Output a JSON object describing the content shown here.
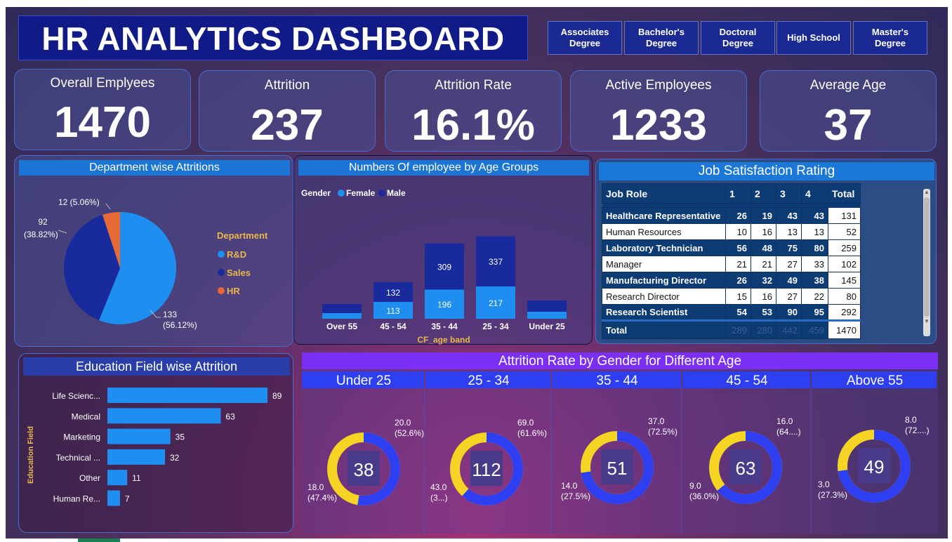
{
  "title": "HR ANALYTICS DASHBOARD",
  "education_slicer": [
    "Associates\nDegree",
    "Bachelor's\nDegree",
    "Doctoral\nDegree",
    "High School",
    "Master's\nDegree"
  ],
  "kpis": [
    {
      "label": "Overall Emplyees",
      "value": "1470"
    },
    {
      "label": "Attrition",
      "value": "237"
    },
    {
      "label": "Attrition Rate",
      "value": "16.1%"
    },
    {
      "label": "Active Employees",
      "value": "1233"
    },
    {
      "label": "Average Age",
      "value": "37"
    }
  ],
  "dept_panel": {
    "title": "Department wise Attritions",
    "legend_title": "Department",
    "legend_color": "#e8b84a"
  },
  "age_panel": {
    "title": "Numbers Of employee by Age Groups",
    "legend_label": "Gender",
    "xlabel": "CF_age band"
  },
  "job_panel": {
    "title": "Job Satisfaction Rating",
    "headers": [
      "Job Role",
      "1",
      "2",
      "3",
      "4",
      "Total"
    ]
  },
  "edu_panel": {
    "title": "Education Field wise Attrition",
    "ylabel": "Education Field"
  },
  "gender_panel": {
    "title": "Attrition Rate by Gender for Different Age"
  },
  "colors": {
    "male": "#182a9c",
    "female": "#1e8ef0",
    "hr": "#e56a36",
    "donut_blue": "#2e3ff2",
    "donut_yellow": "#f5d424",
    "bar": "#1e8ef0"
  },
  "chart_data": [
    {
      "type": "pie",
      "title": "Department wise Attritions",
      "categories": [
        "R&D",
        "Sales",
        "HR"
      ],
      "values": [
        133,
        92,
        12
      ],
      "labels": [
        "133\n(56.12%)",
        "92\n(38.82%)",
        "12 (5.06%)"
      ]
    },
    {
      "type": "bar",
      "stacked": true,
      "title": "Numbers Of employee by Age Groups",
      "xlabel": "CF_age band",
      "categories": [
        "Over 55",
        "45 - 54",
        "35 - 44",
        "25 - 34",
        "Under 25"
      ],
      "series": [
        {
          "name": "Female",
          "values": [
            null,
            113,
            196,
            217,
            null
          ]
        },
        {
          "name": "Male",
          "values": [
            null,
            132,
            309,
            337,
            null
          ]
        }
      ]
    },
    {
      "type": "table",
      "title": "Job Satisfaction Rating",
      "columns": [
        "Job Role",
        "1",
        "2",
        "3",
        "4",
        "Total"
      ],
      "rows": [
        [
          "Healthcare Representative",
          26,
          19,
          43,
          43,
          131
        ],
        [
          "Human Resources",
          10,
          16,
          13,
          13,
          52
        ],
        [
          "Laboratory Technician",
          56,
          48,
          75,
          80,
          259
        ],
        [
          "Manager",
          21,
          21,
          27,
          33,
          102
        ],
        [
          "Manufacturing Director",
          26,
          32,
          49,
          38,
          145
        ],
        [
          "Research Director",
          15,
          16,
          27,
          22,
          80
        ],
        [
          "Research Scientist",
          54,
          53,
          90,
          95,
          292
        ]
      ],
      "total": [
        "Total",
        289,
        280,
        442,
        459,
        1470
      ]
    },
    {
      "type": "bar",
      "orientation": "horizontal",
      "title": "Education Field wise Attrition",
      "ylabel": "Education Field",
      "categories": [
        "Life Scienc...",
        "Medical",
        "Marketing",
        "Technical ...",
        "Other",
        "Human Re..."
      ],
      "values": [
        89,
        63,
        35,
        32,
        11,
        7
      ]
    },
    {
      "type": "pie",
      "donut": true,
      "title": "Attrition Rate by Gender for Different Age",
      "groups": [
        {
          "name": "Under 25",
          "center": "38",
          "blue": 20.0,
          "yellow": 18.0,
          "blue_label": "20.0\n(52.6%)",
          "yellow_label": "18.0\n(47.4%)"
        },
        {
          "name": "25 - 34",
          "center": "112",
          "blue": 69.0,
          "yellow": 43.0,
          "blue_label": "69.0\n(61.6%)",
          "yellow_label": "43.0\n(3...)"
        },
        {
          "name": "35 - 44",
          "center": "51",
          "blue": 37.0,
          "yellow": 14.0,
          "blue_label": "37.0\n(72.5%)",
          "yellow_label": "14.0\n(27.5%)"
        },
        {
          "name": "45 - 54",
          "center": "63",
          "blue": 16.0,
          "yellow": 9.0,
          "blue_label": "16.0\n(64....)",
          "yellow_label": "9.0\n(36.0%)"
        },
        {
          "name": "Above 55",
          "center": "49",
          "blue": 8.0,
          "yellow": 3.0,
          "blue_label": "8.0\n(72....)",
          "yellow_label": "3.0\n(27.3%)"
        }
      ]
    }
  ]
}
